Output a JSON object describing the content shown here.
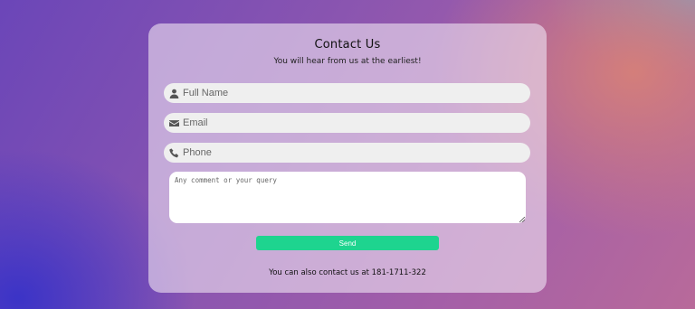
{
  "form": {
    "title": "Contact Us",
    "subtitle": "You will hear from us at the earliest!",
    "fields": [
      {
        "placeholder": "Full Name",
        "icon": "user-icon"
      },
      {
        "placeholder": "Email",
        "icon": "envelope-icon"
      },
      {
        "placeholder": "Phone",
        "icon": "phone-icon"
      }
    ],
    "comment_placeholder": "Any comment or your query",
    "send_label": "Send",
    "footer_text": "You can also contact us at 181-1711-322"
  },
  "colors": {
    "send_button": "#1ed48f",
    "card": "rgba(238,225,240,0.62)",
    "field_bg": "#efefef"
  }
}
